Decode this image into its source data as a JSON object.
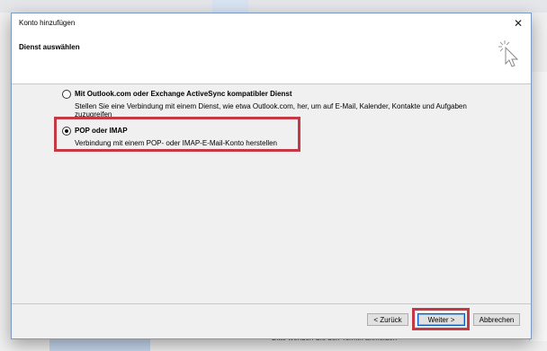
{
  "background": {
    "bottom_text": "Bitte wenden Sie den Termin anmelden"
  },
  "dialog": {
    "title": "Konto hinzufügen",
    "close_glyph": "✕",
    "header_title": "Dienst auswählen",
    "header_icon": "mouse-cursor-sparkle-icon"
  },
  "options": [
    {
      "label": "Mit Outlook.com oder Exchange ActiveSync kompatibler Dienst",
      "description": "Stellen Sie eine Verbindung mit einem Dienst, wie etwa Outlook.com, her, um auf E-Mail, Kalender, Kontakte und Aufgaben zuzugreifen",
      "selected": false
    },
    {
      "label": "POP oder IMAP",
      "description": "Verbindung mit einem POP- oder IMAP-E-Mail-Konto herstellen",
      "selected": true
    }
  ],
  "buttons": {
    "back": "< Zurück",
    "next": "Weiter >",
    "cancel": "Abbrechen"
  },
  "colors": {
    "highlight": "#c33a44",
    "default_button_border": "#0a58c2"
  }
}
